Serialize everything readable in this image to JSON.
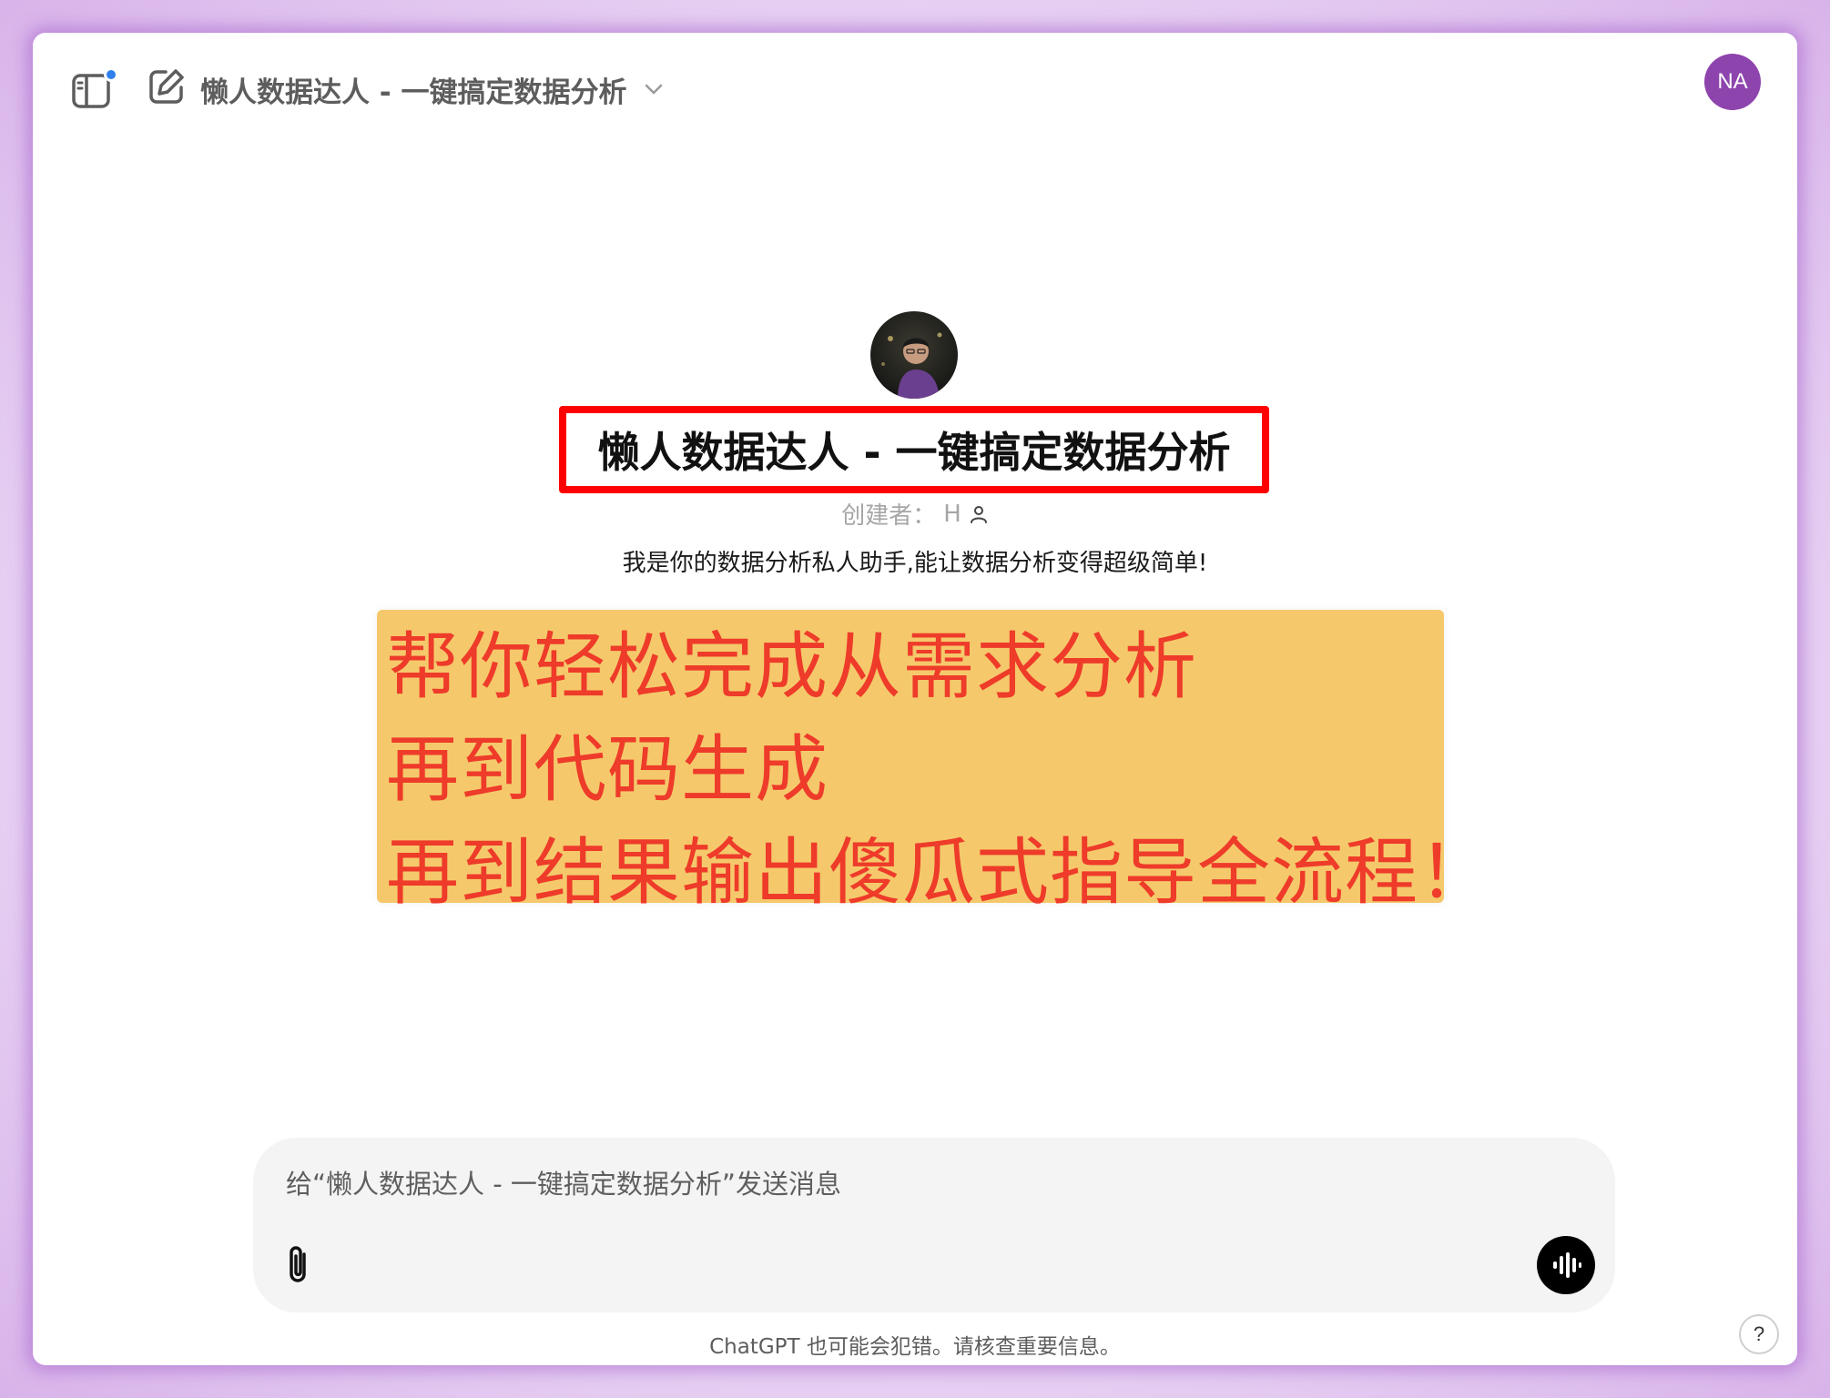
{
  "header": {
    "gpt_name": "懒人数据达人 - 一键搞定数据分析",
    "user_initials": "NA"
  },
  "gpt": {
    "title": "懒人数据达人 - 一键搞定数据分析",
    "creator_label": "创建者：",
    "creator_name": "H",
    "description": "我是你的数据分析私人助手,能让数据分析变得超级简单!"
  },
  "highlight": {
    "lines": [
      "帮你轻松完成从需求分析",
      "再到代码生成",
      "再到结果输出傻瓜式指导全流程！"
    ]
  },
  "composer": {
    "placeholder": "给“懒人数据达人 - 一键搞定数据分析”发送消息"
  },
  "footer": {
    "disclaimer": "ChatGPT 也可能会犯错。请核查重要信息。",
    "help": "?"
  },
  "colors": {
    "notification_dot": "#2f80ed",
    "user_avatar_bg": "#8e44ad",
    "title_box_border": "#ff0000",
    "highlight_bg": "#f5c96b",
    "highlight_text": "#ee3b2a"
  },
  "icons": {
    "sidebar_toggle": "sidebar-toggle-icon",
    "new_chat": "compose-icon",
    "dropdown": "chevron-down-icon",
    "creator": "person-icon",
    "attach": "paperclip-icon",
    "voice": "voice-waveform-icon"
  }
}
